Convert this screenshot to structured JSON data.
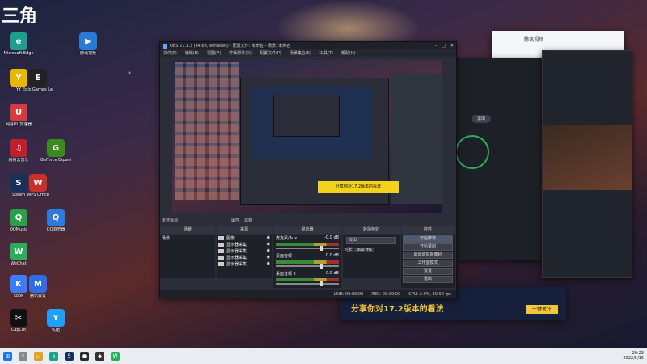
{
  "watermark": "三角",
  "desktop_icons": [
    {
      "label": "腾讯视频",
      "color": "#2a7bd6"
    },
    {
      "label": "Microsoft Edge",
      "color": "#1f9e8f"
    },
    {
      "label": "YY",
      "color": "#e6b800"
    },
    {
      "label": "网易UU加速器",
      "color": "#d63b3b"
    },
    {
      "label": "网易云音乐",
      "color": "#c0202b"
    },
    {
      "label": "Steam",
      "color": "#17325a"
    },
    {
      "label": "QQMusic",
      "color": "#28a048"
    },
    {
      "label": "WeChat",
      "color": "#2aae5c"
    },
    {
      "label": "kook",
      "color": "#3a7bff"
    },
    {
      "label": "CapCut",
      "color": "#111111"
    },
    {
      "label": "Epic Games Launcher",
      "color": "#222222"
    },
    {
      "label": "WPS Office",
      "color": "#c8302c"
    },
    {
      "label": "腾讯会议",
      "color": "#2d6ee6"
    },
    {
      "label": "GeForce Experience",
      "color": "#3a8a1e"
    },
    {
      "label": "QQ浏览器",
      "color": "#2e7be0"
    },
    {
      "label": "优酷",
      "color": "#1ea0ff"
    }
  ],
  "obs": {
    "title": "OBS 27.1.3 (64 bit, windows) - 配置文件: 未命名 - 场景: 未命名",
    "menu": [
      "文件(F)",
      "编辑(E)",
      "视图(V)",
      "停靠部件(D)",
      "配置文件(P)",
      "场景集合(S)",
      "工具(T)",
      "帮助(H)"
    ],
    "no_source_selected": "未选择源",
    "properties_btn": "属性",
    "filters_btn": "滤镜",
    "docks": {
      "scenes": "场景",
      "sources": "来源",
      "mixer": "混音器",
      "transitions": "转场特效",
      "controls": "控件"
    },
    "scene_item": "场景",
    "sources": [
      "图像",
      "显示器采集",
      "显示器采集",
      "显示器采集",
      "显示器采集"
    ],
    "mixer": [
      {
        "name": "麦克风/Aux",
        "db": "-0.0 dB"
      },
      {
        "name": "桌面音频",
        "db": "0.0 dB"
      },
      {
        "name": "桌面音频 2",
        "db": "0.0 dB"
      }
    ],
    "transition": {
      "type": "淡出",
      "duration_label": "时长",
      "duration": "300 ms"
    },
    "controls": [
      "开始推流",
      "开始录制",
      "启动虚拟摄像机",
      "工作室模式",
      "设置",
      "退出"
    ],
    "status": {
      "live": "LIVE: 00:00:00",
      "rec": "REC: 00:00:00",
      "cpu": "CPU: 2.0%, 30.00 fps"
    }
  },
  "right_windows": {
    "chat_title": "腾讯视频",
    "exit_btn": "退出",
    "promo_text": "分享你对17.2版本的看法",
    "follow_btn": "一键关注"
  },
  "clock": {
    "time": "20:23",
    "date": "2022/5/15"
  }
}
